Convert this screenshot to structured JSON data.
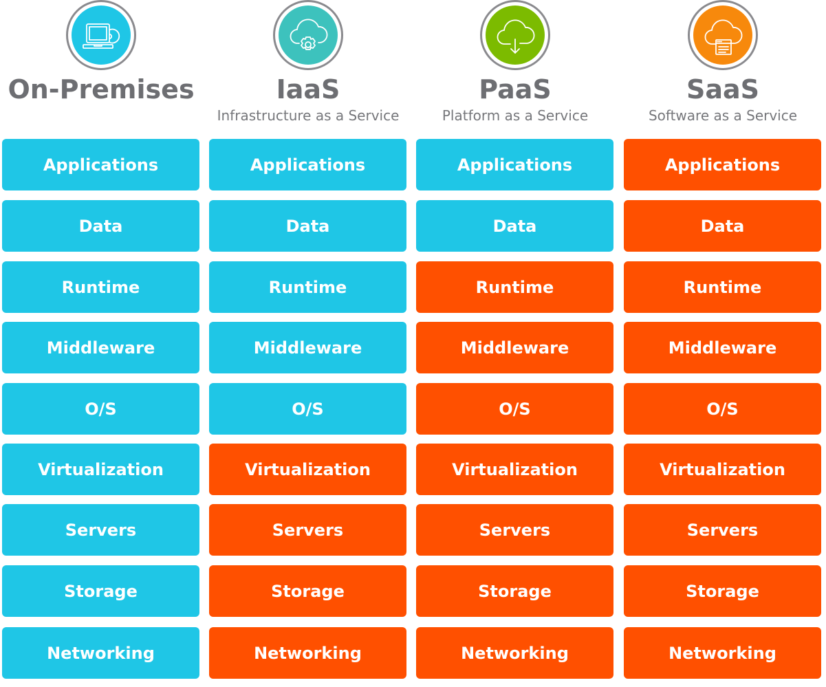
{
  "colors": {
    "you_manage": "#1FC6E6",
    "vendor_manages": "#FF5000",
    "title_text": "#6D6E72",
    "icon_ring": "#8A8A8E"
  },
  "columns": [
    {
      "title": "On-Premises",
      "subtitle": "",
      "icon": "laptop-disc-icon",
      "icon_color": "#1FC6E6",
      "layers": [
        {
          "label": "Applications",
          "managed_by": "you"
        },
        {
          "label": "Data",
          "managed_by": "you"
        },
        {
          "label": "Runtime",
          "managed_by": "you"
        },
        {
          "label": "Middleware",
          "managed_by": "you"
        },
        {
          "label": "O/S",
          "managed_by": "you"
        },
        {
          "label": "Virtualization",
          "managed_by": "you"
        },
        {
          "label": "Servers",
          "managed_by": "you"
        },
        {
          "label": "Storage",
          "managed_by": "you"
        },
        {
          "label": "Networking",
          "managed_by": "you"
        }
      ]
    },
    {
      "title": "IaaS",
      "subtitle": "Infrastructure as a Service",
      "icon": "cloud-gear-icon",
      "icon_color": "#3DC2BD",
      "layers": [
        {
          "label": "Applications",
          "managed_by": "you"
        },
        {
          "label": "Data",
          "managed_by": "you"
        },
        {
          "label": "Runtime",
          "managed_by": "you"
        },
        {
          "label": "Middleware",
          "managed_by": "you"
        },
        {
          "label": "O/S",
          "managed_by": "you"
        },
        {
          "label": "Virtualization",
          "managed_by": "vendor"
        },
        {
          "label": "Servers",
          "managed_by": "vendor"
        },
        {
          "label": "Storage",
          "managed_by": "vendor"
        },
        {
          "label": "Networking",
          "managed_by": "vendor"
        }
      ]
    },
    {
      "title": "PaaS",
      "subtitle": "Platform as a Service",
      "icon": "cloud-download-icon",
      "icon_color": "#7CBB00",
      "layers": [
        {
          "label": "Applications",
          "managed_by": "you"
        },
        {
          "label": "Data",
          "managed_by": "you"
        },
        {
          "label": "Runtime",
          "managed_by": "vendor"
        },
        {
          "label": "Middleware",
          "managed_by": "vendor"
        },
        {
          "label": "O/S",
          "managed_by": "vendor"
        },
        {
          "label": "Virtualization",
          "managed_by": "vendor"
        },
        {
          "label": "Servers",
          "managed_by": "vendor"
        },
        {
          "label": "Storage",
          "managed_by": "vendor"
        },
        {
          "label": "Networking",
          "managed_by": "vendor"
        }
      ]
    },
    {
      "title": "SaaS",
      "subtitle": "Software as a Service",
      "icon": "cloud-window-icon",
      "icon_color": "#F7890C",
      "layers": [
        {
          "label": "Applications",
          "managed_by": "vendor"
        },
        {
          "label": "Data",
          "managed_by": "vendor"
        },
        {
          "label": "Runtime",
          "managed_by": "vendor"
        },
        {
          "label": "Middleware",
          "managed_by": "vendor"
        },
        {
          "label": "O/S",
          "managed_by": "vendor"
        },
        {
          "label": "Virtualization",
          "managed_by": "vendor"
        },
        {
          "label": "Servers",
          "managed_by": "vendor"
        },
        {
          "label": "Storage",
          "managed_by": "vendor"
        },
        {
          "label": "Networking",
          "managed_by": "vendor"
        }
      ]
    }
  ]
}
